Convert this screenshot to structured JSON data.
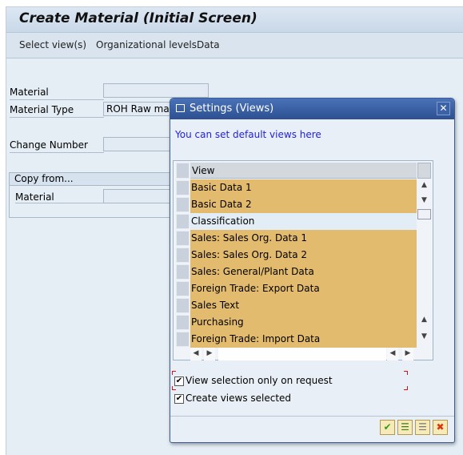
{
  "window": {
    "title": "Create Material (Initial Screen)"
  },
  "toolbar": {
    "items": [
      "Select view(s)",
      "Organizational levels",
      "Data"
    ]
  },
  "form": {
    "material_label": "Material",
    "material_value": "",
    "material_type_label": "Material Type",
    "material_type_value": "ROH Raw material",
    "change_number_label": "Change Number",
    "change_number_value": "",
    "copy_from": {
      "title": "Copy from...",
      "material_label": "Material",
      "material_value": ""
    }
  },
  "dialog": {
    "title": "Settings (Views)",
    "info": "You can set default views here",
    "table": {
      "header": "View",
      "rows": [
        {
          "label": "Basic Data 1",
          "selected": true
        },
        {
          "label": "Basic Data 2",
          "selected": true
        },
        {
          "label": "Classification",
          "selected": false
        },
        {
          "label": "Sales: Sales Org. Data 1",
          "selected": true
        },
        {
          "label": "Sales: Sales Org. Data 2",
          "selected": true
        },
        {
          "label": "Sales: General/Plant Data",
          "selected": true
        },
        {
          "label": "Foreign Trade: Export Data",
          "selected": true
        },
        {
          "label": "Sales Text",
          "selected": true
        },
        {
          "label": "Purchasing",
          "selected": true
        },
        {
          "label": "Foreign Trade: Import Data",
          "selected": true
        }
      ]
    },
    "checkboxes": [
      {
        "label": "View selection only on request",
        "checked": true
      },
      {
        "label": "Create views selected",
        "checked": true
      }
    ],
    "buttons": [
      "confirm-icon",
      "select-all-icon",
      "deselect-all-icon",
      "cancel-icon"
    ]
  },
  "colors": {
    "selected_row": "#e3bb6e",
    "dialog_title": "#2c5091",
    "info_text": "#2222dd"
  }
}
